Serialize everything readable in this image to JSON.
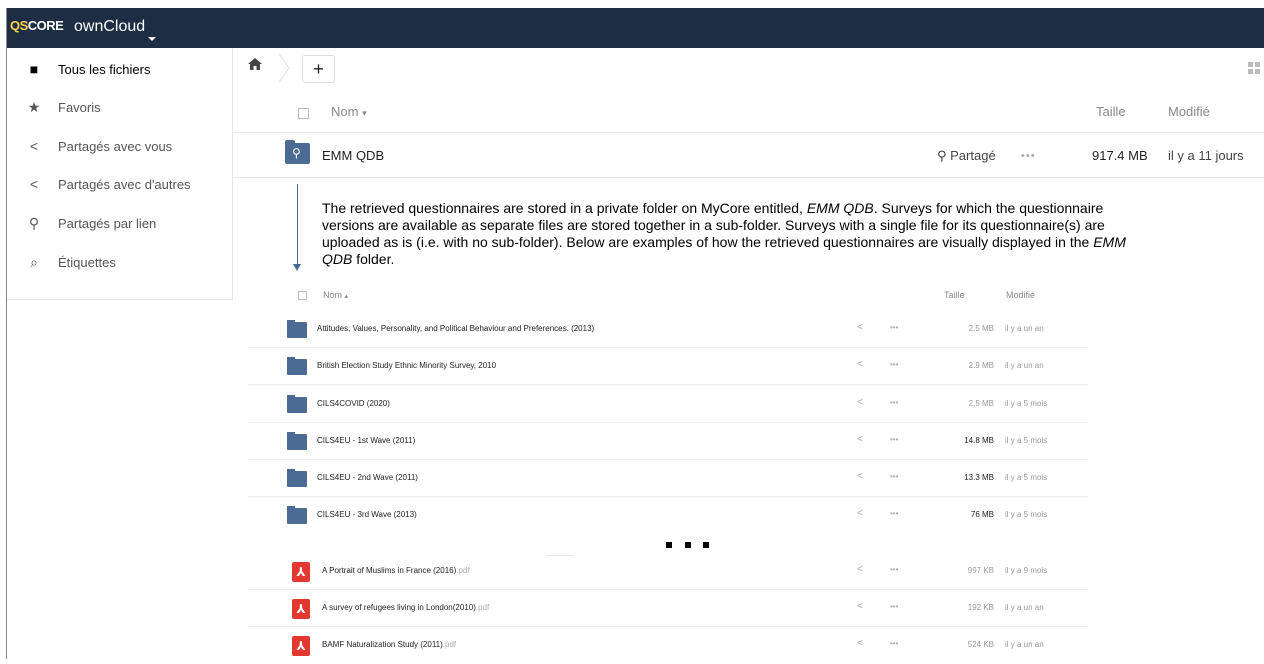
{
  "header": {
    "logo_prefix": "QS",
    "logo_text": "CORE",
    "app_name": "ownCloud"
  },
  "sidebar": {
    "items": [
      {
        "label": "Tous les fichiers",
        "icon": "folder-icon",
        "active": true
      },
      {
        "label": "Favoris",
        "icon": "star-icon"
      },
      {
        "label": "Partagés avec vous",
        "icon": "share-icon"
      },
      {
        "label": "Partagés avec d'autres",
        "icon": "share-icon"
      },
      {
        "label": "Partagés par lien",
        "icon": "link-icon"
      },
      {
        "label": "Étiquettes",
        "icon": "search-icon"
      }
    ]
  },
  "toolbar": {
    "add_label": "+"
  },
  "file_table": {
    "col_name": "Nom",
    "col_size": "Taille",
    "col_modified": "Modifié"
  },
  "main_row": {
    "name": "EMM QDB",
    "shared_label": "Partagé",
    "more": "•••",
    "size": "917.4 MB",
    "modified": "il y a 11 jours"
  },
  "annotation": {
    "p1": "The retrieved questionnaires are stored in a private folder on MyCore entitled, ",
    "em1": "EMM QDB",
    "p2": ". Surveys for which the questionnaire versions are available as separate files are stored together in a sub-folder. Surveys with a single file for its questionnaire(s) are uploaded as is (i.e. with no sub-folder). Below are examples of how the retrieved questionnaires are visually displayed in the ",
    "em2": "EMM QDB",
    "p3": " folder."
  },
  "sub_table": {
    "col_name": "Nom",
    "col_size": "Taille",
    "col_modified": "Modifié",
    "folders": [
      {
        "name": "Attitudes, Values, Personality, and Political Behaviour and Preferences. (2013)",
        "size": "2.5 MB",
        "modified": "il y a un an"
      },
      {
        "name": "British Election Study Ethnic Minority Survey, 2010",
        "size": "2.9 MB",
        "modified": "il y a un an"
      },
      {
        "name": "CILS4COVID (2020)",
        "size": "2.5 MB",
        "modified": "il y a 5 mois"
      },
      {
        "name": "CILS4EU - 1st Wave (2011)",
        "size": "14.8 MB",
        "modified": "il y a 5 mois"
      },
      {
        "name": "CILS4EU - 2nd Wave (2011)",
        "size": "13.3 MB",
        "modified": "il y a 5 mois"
      },
      {
        "name": "CILS4EU - 3rd Wave (2013)",
        "size": "76 MB",
        "modified": "il y a 5 mois"
      }
    ],
    "files": [
      {
        "name": "A Portrait of Muslims in France (2016)",
        "ext": ".pdf",
        "size": "997 KB",
        "modified": "il y a 9 mois"
      },
      {
        "name": "A survey of refugees living in London(2010)",
        "ext": ".pdf",
        "size": "192 KB",
        "modified": "il y a un an"
      },
      {
        "name": "BAMF Naturalization Study (2011)",
        "ext": ".pdf",
        "size": "524 KB",
        "modified": "il y a un an"
      }
    ]
  },
  "colors": {
    "header_bg": "#1d2d44",
    "folder": "#4c6b94",
    "pdf": "#e2382f"
  }
}
